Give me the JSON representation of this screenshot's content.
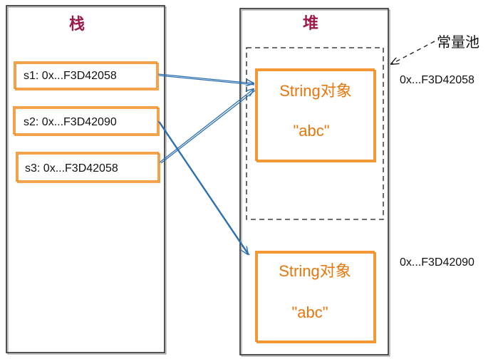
{
  "stack": {
    "title": "栈",
    "vars": [
      {
        "label": "s1: 0x...F3D42058"
      },
      {
        "label": "s2: 0x...F3D42090"
      },
      {
        "label": "s3: 0x...F3D42058"
      }
    ]
  },
  "heap": {
    "title": "堆",
    "pool_label": "常量池",
    "objects": [
      {
        "type_label": "String对象",
        "value_label": "\"abc\"",
        "address": "0x...F3D42058"
      },
      {
        "type_label": "String对象",
        "value_label": "\"abc\"",
        "address": "0x...F3D42090"
      }
    ]
  },
  "colors": {
    "title": "#9b1a4b",
    "box_border": "#f08c1e",
    "object_text": "#e8760c",
    "arrow": "#2a6fb0"
  }
}
